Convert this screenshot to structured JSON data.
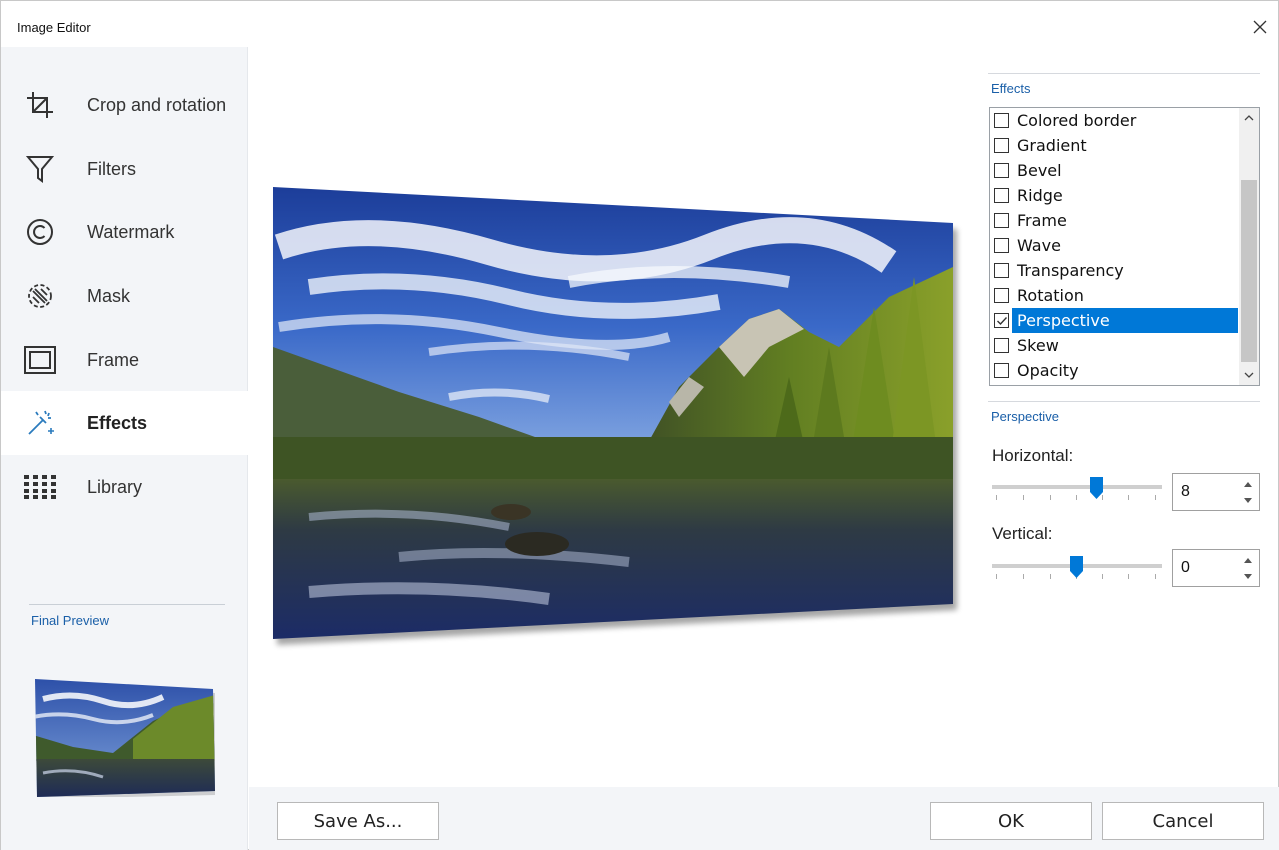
{
  "window": {
    "title": "Image Editor"
  },
  "sidebar": {
    "items": [
      {
        "label": "Crop and rotation",
        "icon": "crop-icon"
      },
      {
        "label": "Filters",
        "icon": "filter-icon"
      },
      {
        "label": "Watermark",
        "icon": "copyright-icon"
      },
      {
        "label": "Mask",
        "icon": "mask-icon"
      },
      {
        "label": "Frame",
        "icon": "frame-icon"
      },
      {
        "label": "Effects",
        "icon": "magic-wand-icon",
        "active": true
      },
      {
        "label": "Library",
        "icon": "grid-icon"
      }
    ],
    "preview_label": "Final Preview"
  },
  "effects_panel": {
    "label": "Effects",
    "items": [
      {
        "label": "Colored border",
        "checked": false
      },
      {
        "label": "Gradient",
        "checked": false
      },
      {
        "label": "Bevel",
        "checked": false
      },
      {
        "label": "Ridge",
        "checked": false
      },
      {
        "label": "Frame",
        "checked": false
      },
      {
        "label": "Wave",
        "checked": false
      },
      {
        "label": "Transparency",
        "checked": false
      },
      {
        "label": "Rotation",
        "checked": false
      },
      {
        "label": "Perspective",
        "checked": true,
        "selected": true
      },
      {
        "label": "Skew",
        "checked": false
      },
      {
        "label": "Opacity",
        "checked": false
      }
    ]
  },
  "perspective": {
    "label": "Perspective",
    "horizontal": {
      "label": "Horizontal:",
      "value": "8"
    },
    "vertical": {
      "label": "Vertical:",
      "value": "0"
    }
  },
  "buttons": {
    "save_as": "Save As...",
    "ok": "OK",
    "cancel": "Cancel"
  },
  "colors": {
    "accent": "#0078d7",
    "group_label": "#1a5fa8",
    "sidebar_bg": "#f3f5f8"
  }
}
